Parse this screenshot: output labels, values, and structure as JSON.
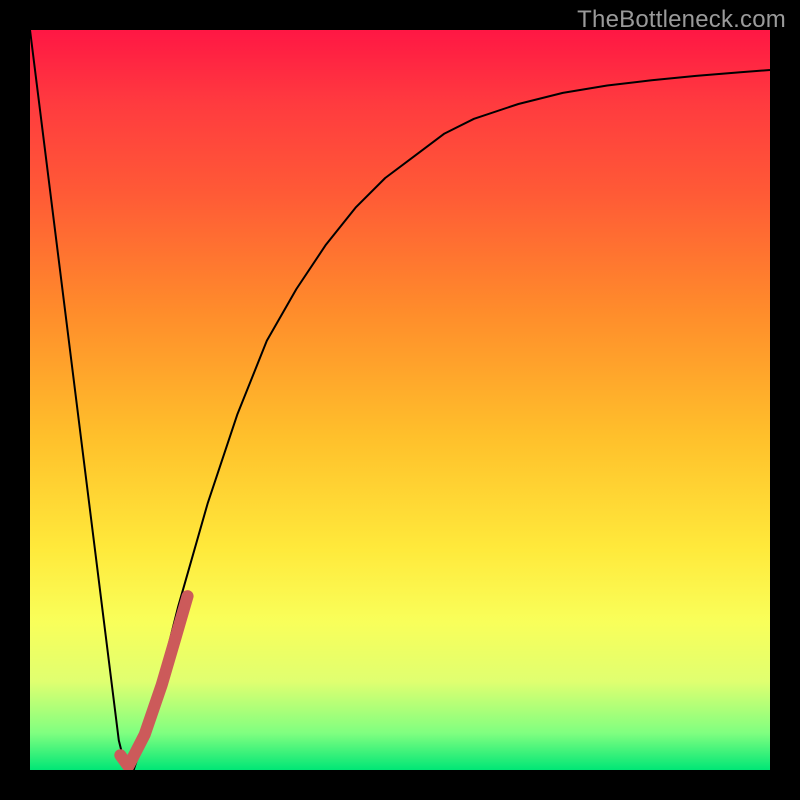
{
  "watermark": {
    "text": "TheBottleneck.com"
  },
  "chart_data": {
    "type": "line",
    "title": "",
    "xlabel": "",
    "ylabel": "",
    "xlim": [
      0,
      100
    ],
    "ylim": [
      0,
      100
    ],
    "series": [
      {
        "name": "black-curve",
        "color": "#000000",
        "stroke_width": 2,
        "x": [
          0,
          2,
          4,
          6,
          8,
          10,
          12,
          13,
          14,
          16,
          18,
          20,
          24,
          28,
          32,
          36,
          40,
          44,
          48,
          52,
          56,
          60,
          66,
          72,
          78,
          84,
          90,
          96,
          100
        ],
        "values": [
          100,
          84,
          68,
          52,
          36,
          20,
          4,
          0,
          0,
          6,
          14,
          22,
          36,
          48,
          58,
          65,
          71,
          76,
          80,
          83,
          86,
          88,
          90,
          91.5,
          92.5,
          93.2,
          93.8,
          94.3,
          94.6
        ]
      },
      {
        "name": "red-elbow",
        "color": "#cc5a5a",
        "stroke_width": 12,
        "x": [
          12.2,
          13.3,
          15.5,
          17.8,
          19.7,
          21.3
        ],
        "values": [
          2.0,
          0.5,
          4.8,
          11.5,
          18.0,
          23.5
        ]
      }
    ]
  }
}
